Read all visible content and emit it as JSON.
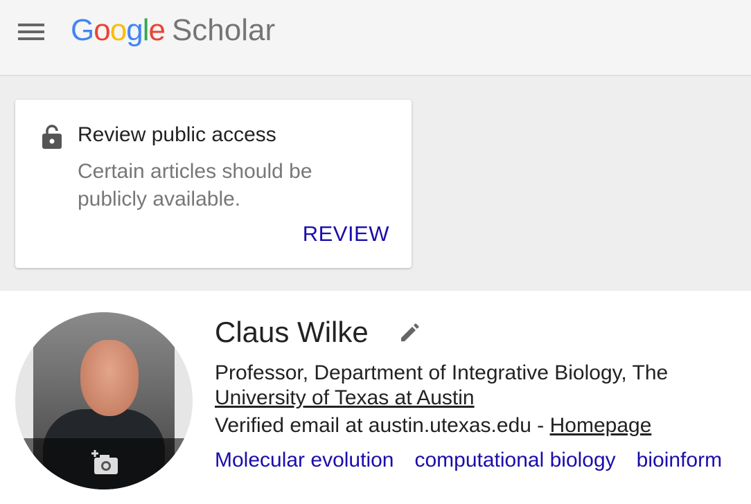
{
  "header": {
    "logo_letters": [
      "G",
      "o",
      "o",
      "g",
      "l",
      "e"
    ],
    "logo_product": "Scholar",
    "menu_icon": "hamburger-menu-icon"
  },
  "access_card": {
    "icon": "lock-icon",
    "title": "Review public access",
    "description": "Certain articles should be publicly available.",
    "action_label": "REVIEW"
  },
  "profile": {
    "name": "Claus Wilke",
    "edit_icon": "pencil-icon",
    "affiliation_prefix": "Professor, Department of Integrative Biology, The ",
    "affiliation_link": "University of Texas at Austin",
    "email_text": "Verified email at austin.utexas.edu - ",
    "homepage_label": "Homepage",
    "photo_icon": "add-photo-icon",
    "interests": [
      "Molecular evolution",
      "computational biology",
      "bioinform"
    ]
  },
  "colors": {
    "link_blue": "#1a0dab",
    "google_blue": "#4285f4",
    "google_red": "#ea4335",
    "google_yellow": "#fbbc05",
    "google_green": "#34a853"
  }
}
